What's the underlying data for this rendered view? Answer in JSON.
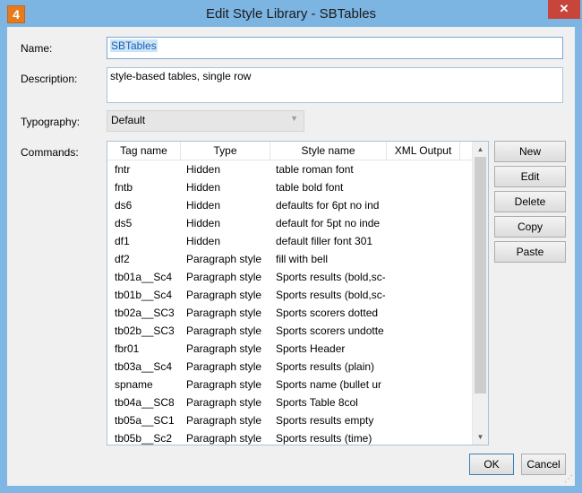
{
  "window": {
    "title": "Edit Style Library - SBTables",
    "app_icon_glyph": "4",
    "controls": {
      "minimize": "—",
      "maximize": "▢",
      "close": "✕"
    }
  },
  "form": {
    "name_label": "Name:",
    "name_value": "SBTables",
    "description_label": "Description:",
    "description_value": "style-based tables, single row",
    "typography_label": "Typography:",
    "typography_value": "Default",
    "commands_label": "Commands:"
  },
  "table": {
    "columns": [
      "Tag name",
      "Type",
      "Style name",
      "XML Output"
    ],
    "rows": [
      [
        "fntr",
        "Hidden",
        "table roman font",
        ""
      ],
      [
        "fntb",
        "Hidden",
        "table bold font",
        ""
      ],
      [
        "ds6",
        "Hidden",
        "defaults for 6pt no ind",
        ""
      ],
      [
        "ds5",
        "Hidden",
        "default for 5pt no inde",
        ""
      ],
      [
        "df1",
        "Hidden",
        "default filler font 301",
        ""
      ],
      [
        "df2",
        "Paragraph style",
        "fill with bell",
        ""
      ],
      [
        "tb01a__Sc4",
        "Paragraph style",
        "Sports results (bold,sc-",
        ""
      ],
      [
        "tb01b__Sc4",
        "Paragraph style",
        "Sports results (bold,sc-",
        ""
      ],
      [
        "tb02a__SC3",
        "Paragraph style",
        "Sports scorers dotted",
        ""
      ],
      [
        "tb02b__SC3",
        "Paragraph style",
        "Sports scorers undotte",
        ""
      ],
      [
        "fbr01",
        "Paragraph style",
        "Sports Header",
        ""
      ],
      [
        "tb03a__Sc4",
        "Paragraph style",
        "Sports results (plain)",
        ""
      ],
      [
        "spname",
        "Paragraph style",
        "Sports name (bullet ur",
        ""
      ],
      [
        "tb04a__SC8",
        "Paragraph style",
        "Sports Table 8col",
        ""
      ],
      [
        "tb05a__SC1",
        "Paragraph style",
        "Sports results empty",
        ""
      ],
      [
        "tb05b__Sc2",
        "Paragraph style",
        "Sports results (time)",
        ""
      ]
    ]
  },
  "buttons": {
    "new": "New",
    "edit": "Edit",
    "delete": "Delete",
    "copy": "Copy",
    "paste": "Paste",
    "ok": "OK",
    "cancel": "Cancel"
  }
}
